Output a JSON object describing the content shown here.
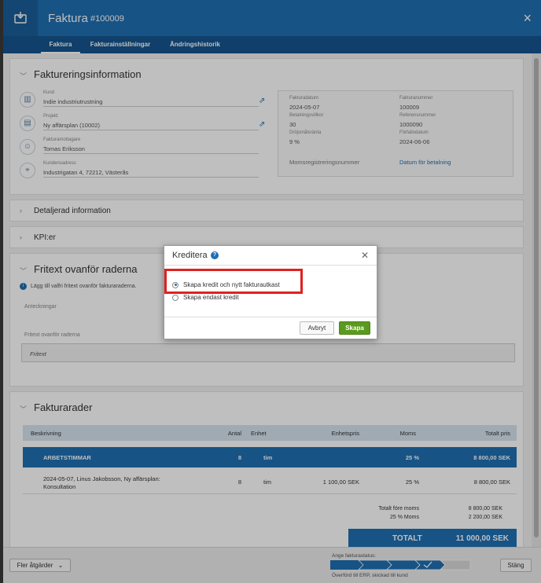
{
  "window": {
    "title": "Faktura",
    "number": "#100009",
    "close_icon": "×"
  },
  "tabs": [
    {
      "label": "Faktura"
    },
    {
      "label": "Fakturainställningar"
    },
    {
      "label": "Ändringshistorik"
    }
  ],
  "invoicing": {
    "title": "Faktureringsinformation",
    "customer_label": "Kund",
    "customer": "Indie industriutrustning",
    "project_label": "Projekt",
    "project": "Ny affärsplan (10002)",
    "recipient_label": "Fakturamottagare",
    "recipient": "Tomas Eriksson",
    "address_label": "Kundensadress",
    "address": "Industrigatan 4, 72212, Västerås",
    "invoice_date_label": "Fakturadatum",
    "invoice_date": "2024-05-07",
    "invoice_number_label": "Fakturanummer",
    "invoice_number": "100009",
    "payment_terms_label": "Betalningsvillkor",
    "payment_terms": "30",
    "reference_label": "Referensnummer",
    "reference": "1000090",
    "late_fee_label": "Dröjsmålsränta",
    "late_fee": "9 %",
    "due_date_label": "Förfallodatum",
    "due_date": "2024-06-06",
    "vat_reg_label": "Momsregistreringsnummer",
    "payment_date_link": "Datum för betalning"
  },
  "sections": {
    "detailed": "Detaljerad information",
    "kpi": "KPI:er",
    "freetext_title": "Fritext ovanför raderna",
    "freetext_info": "Lägg till valfri fritext ovanför fakturaraderna.",
    "notes_label": "Anteckningar",
    "freetext_label": "Fritext ovanför raderna",
    "freetext_placeholder": "Fritext",
    "rows_title": "Fakturarader"
  },
  "table": {
    "headers": {
      "desc": "Beskrivning",
      "qty": "Antal",
      "unit": "Enhet",
      "price": "Enhetspris",
      "vat": "Moms",
      "total": "Totalt pris"
    },
    "group": {
      "desc": "ARBETSTIMMAR",
      "qty": "8",
      "unit": "tim",
      "vat": "25 %",
      "total": "8 800,00 SEK"
    },
    "line": {
      "desc1": "2024-05-07, Linus Jakobsson, Ny affärsplan:",
      "desc2": "Konsultation",
      "qty": "8",
      "unit": "tim",
      "price": "1 100,00 SEK",
      "vat": "25 %",
      "total": "8 800,00 SEK"
    }
  },
  "totals": {
    "before_vat_label": "Totalt före moms",
    "before_vat": "8 800,00 SEK",
    "vat_label": "25 % Moms",
    "vat": "2 200,00 SEK",
    "total_label": "TOTALT",
    "total": "11 000,00 SEK"
  },
  "footer": {
    "more_actions": "Fler åtgärder",
    "status_label": "Ange fakturastatus:",
    "status_text": "Överförd till ERP, skickad till kund",
    "close_button": "Stäng"
  },
  "dialog": {
    "title": "Kreditera",
    "help_icon": "?",
    "option1": "Skapa kredit och nytt fakturautkast",
    "option2": "Skapa endast kredit",
    "cancel": "Avbryt",
    "create": "Skapa"
  },
  "colors": {
    "brand": "#1f6fb2",
    "highlight": "#e02020",
    "create_button": "#5a9a1e"
  }
}
